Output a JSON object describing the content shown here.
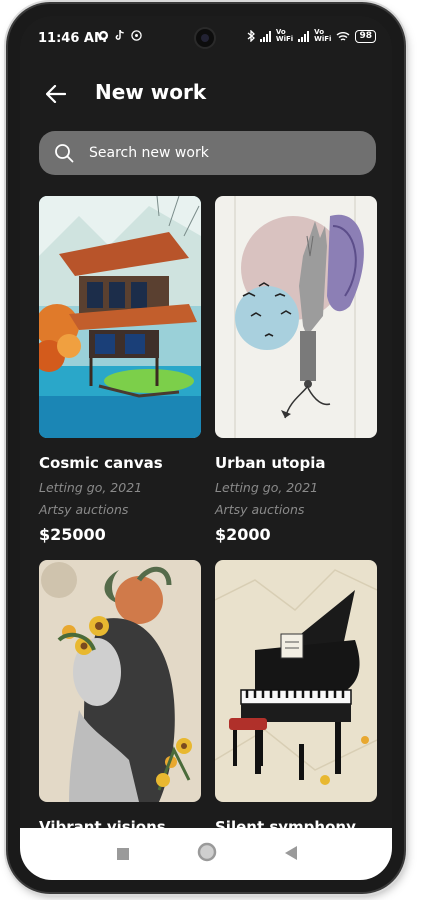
{
  "status_bar": {
    "time": "11:46 AM",
    "volte1": "Vo\nWiFi",
    "battery": "98"
  },
  "header": {
    "title": "New work"
  },
  "search": {
    "placeholder": "Search new work"
  },
  "artworks": [
    {
      "name": "Cosmic canvas",
      "meta": "Letting go, 2021",
      "source": "Artsy auctions",
      "price": "$25000"
    },
    {
      "name": "Urban utopia",
      "meta": "Letting go, 2021",
      "source": "Artsy auctions",
      "price": "$2000"
    },
    {
      "name": "Vibrant visions"
    },
    {
      "name": "Silent symphony"
    }
  ],
  "colors": {
    "background": "#1c1c1c",
    "search_bg": "#707070",
    "muted_text": "#8a8a8a"
  }
}
